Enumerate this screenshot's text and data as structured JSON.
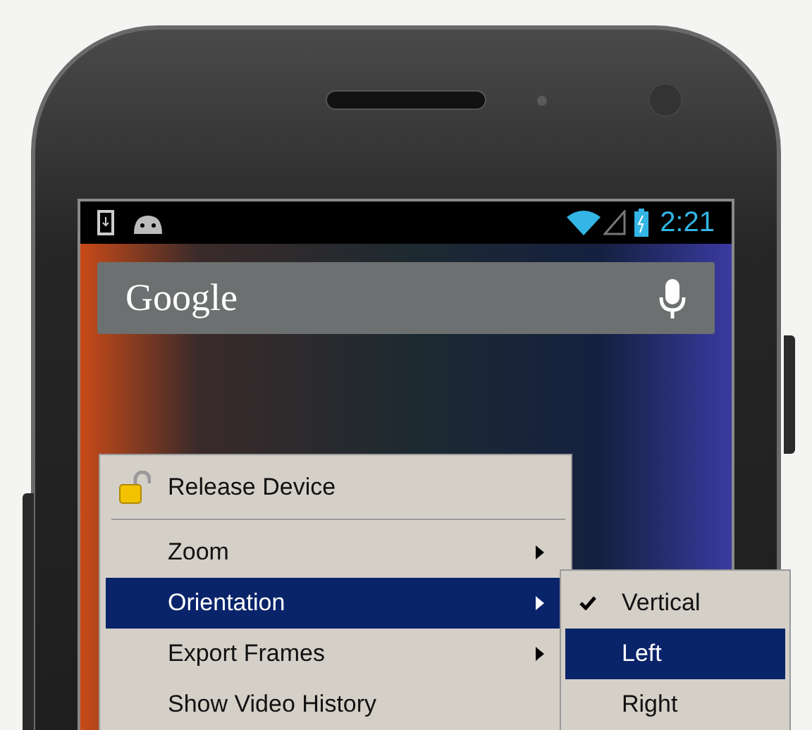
{
  "status_bar": {
    "time": "2:21"
  },
  "search_bar": {
    "logo_text": "Google"
  },
  "context_menu": {
    "items": [
      {
        "kind": "icon_item",
        "label": "Release Device",
        "selected": false
      },
      {
        "kind": "separator"
      },
      {
        "kind": "submenu",
        "label": "Zoom",
        "selected": false
      },
      {
        "kind": "submenu",
        "label": "Orientation",
        "selected": true
      },
      {
        "kind": "submenu",
        "label": "Export Frames",
        "selected": false
      },
      {
        "kind": "item",
        "label": "Show Video History",
        "selected": false
      }
    ]
  },
  "orientation_submenu": {
    "items": [
      {
        "label": "Vertical",
        "checked": true,
        "selected": false
      },
      {
        "label": "Left",
        "checked": false,
        "selected": true
      },
      {
        "label": "Right",
        "checked": false,
        "selected": false
      }
    ]
  }
}
